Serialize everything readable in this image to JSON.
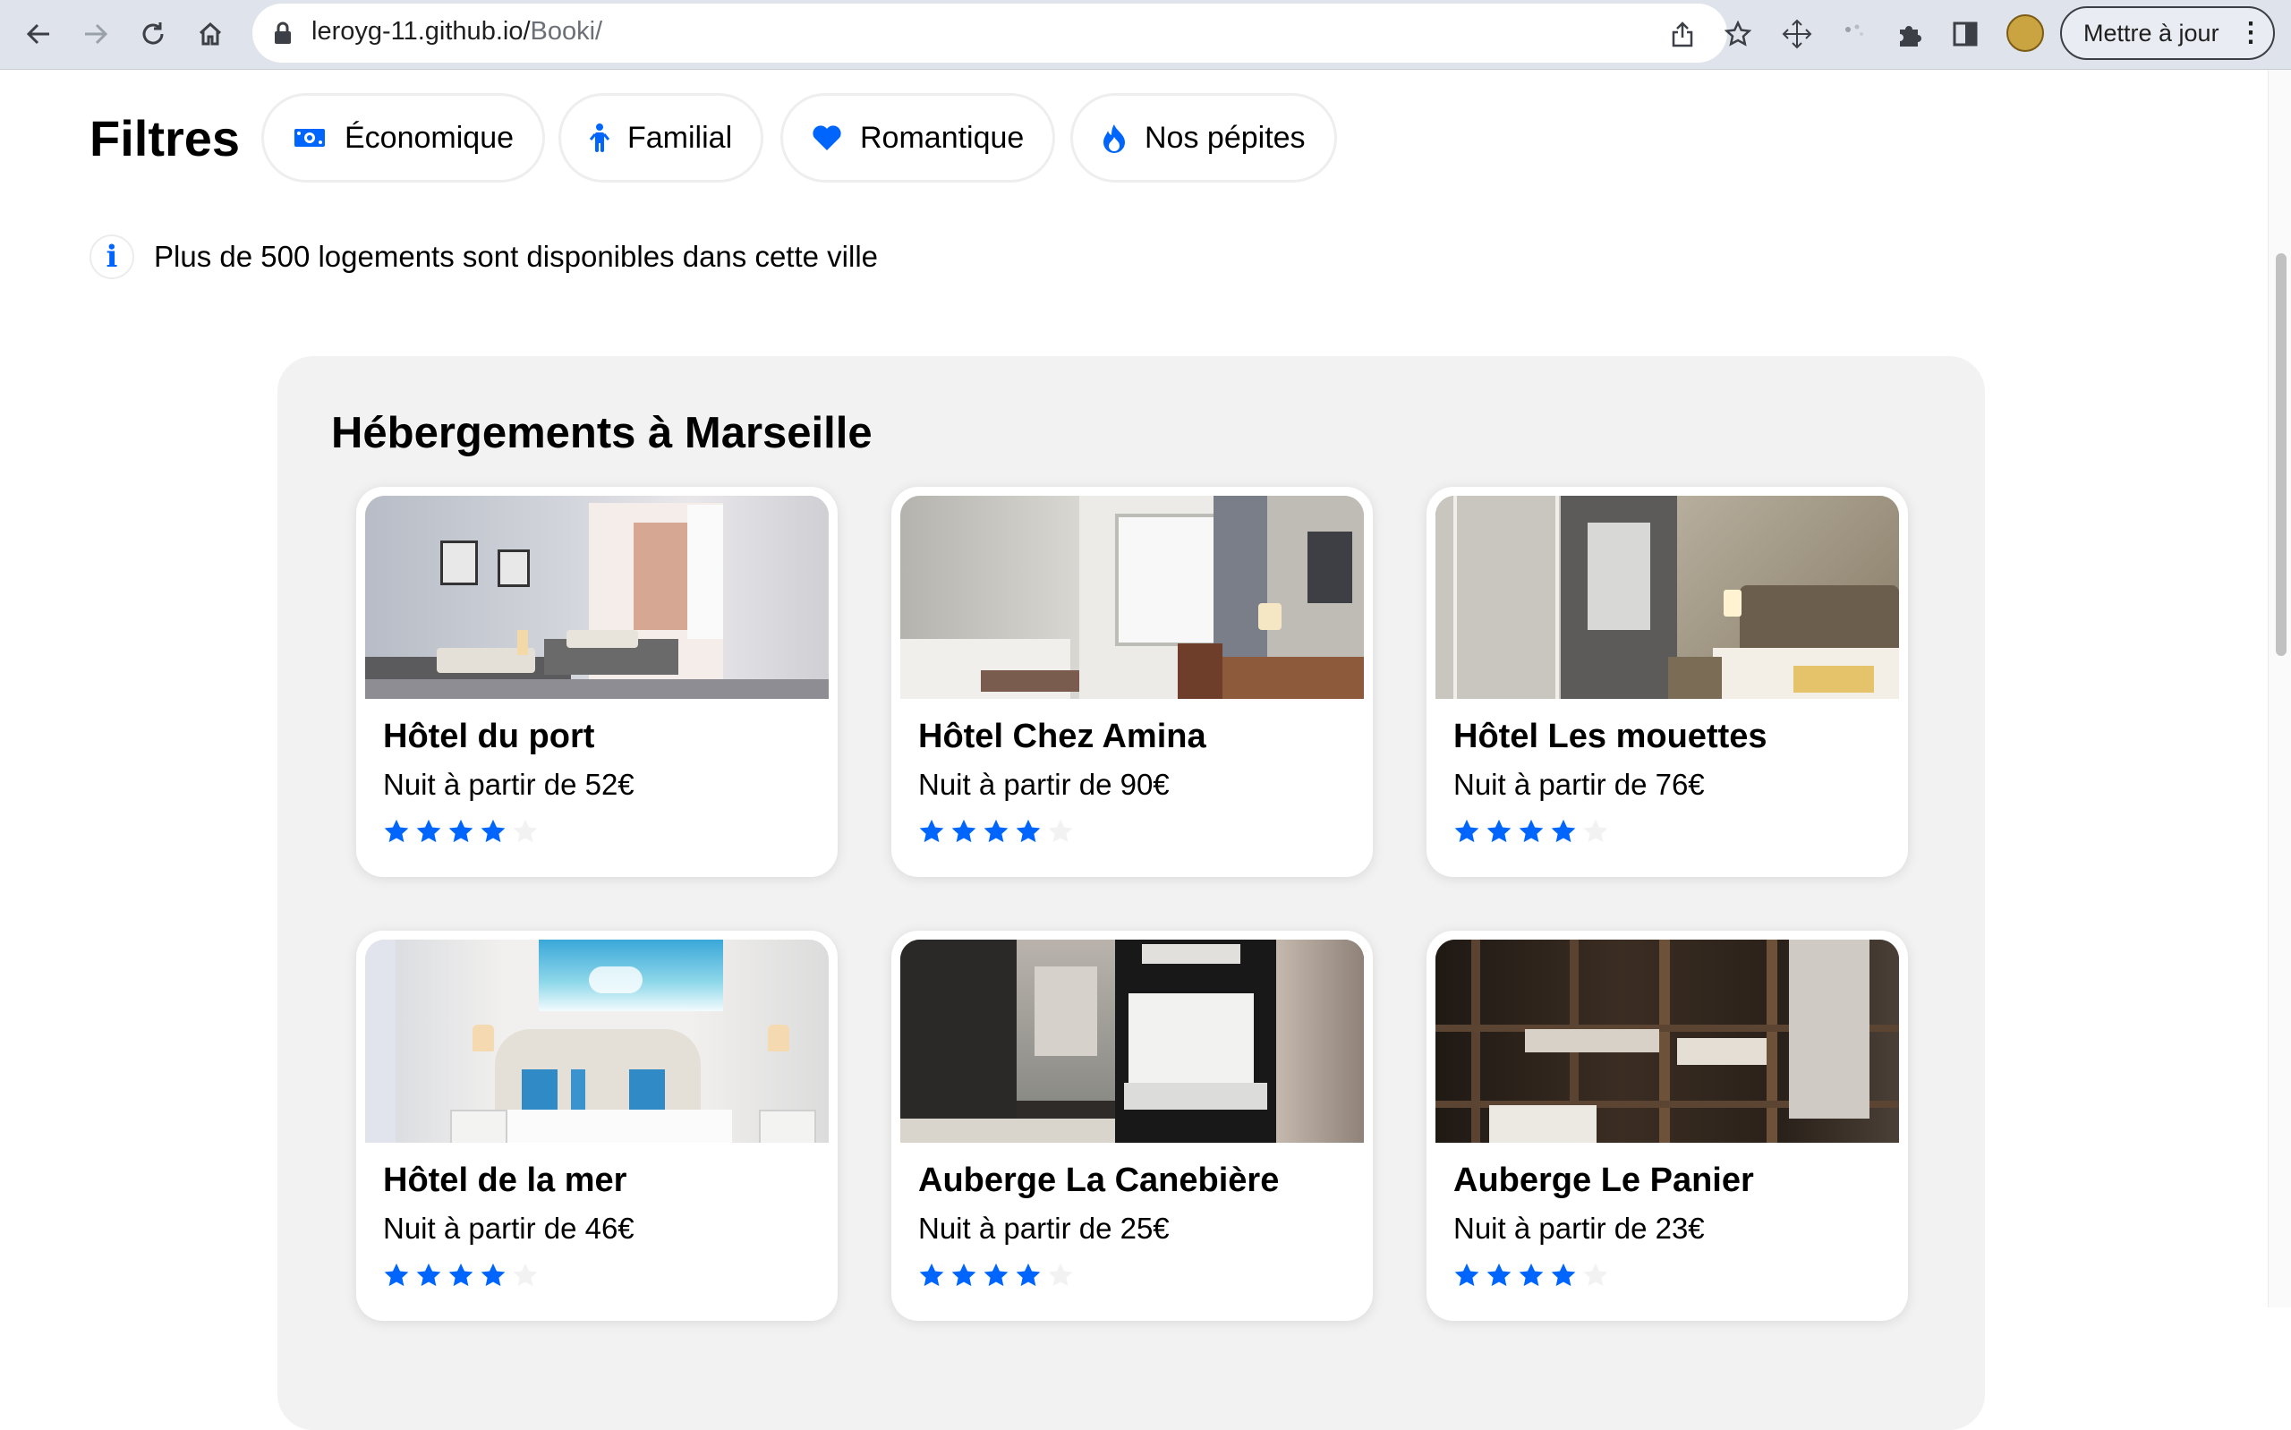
{
  "browser": {
    "url_host": "leroyg-11.github.io/",
    "url_path": "Booki/",
    "update_button": "Mettre à jour"
  },
  "filters": {
    "title": "Filtres",
    "items": [
      {
        "label": "Économique",
        "icon": "money-bill-icon"
      },
      {
        "label": "Familial",
        "icon": "child-icon"
      },
      {
        "label": "Romantique",
        "icon": "heart-icon"
      },
      {
        "label": "Nos pépites",
        "icon": "fire-icon"
      }
    ]
  },
  "info": {
    "text": "Plus de 500 logements sont disponibles dans cette ville"
  },
  "lodgings": {
    "title": "Hébergements à Marseille",
    "items": [
      {
        "name": "Hôtel du port",
        "price": "Nuit à partir de 52€",
        "rating": 4,
        "max_rating": 5
      },
      {
        "name": "Hôtel Chez Amina",
        "price": "Nuit à partir de 90€",
        "rating": 4,
        "max_rating": 5
      },
      {
        "name": "Hôtel Les mouettes",
        "price": "Nuit à partir de 76€",
        "rating": 4,
        "max_rating": 5
      },
      {
        "name": "Hôtel de la mer",
        "price": "Nuit à partir de 46€",
        "rating": 4,
        "max_rating": 5
      },
      {
        "name": "Auberge La Canebière",
        "price": "Nuit à partir de 25€",
        "rating": 4,
        "max_rating": 5
      },
      {
        "name": "Auberge Le Panier",
        "price": "Nuit à partir de 23€",
        "rating": 4,
        "max_rating": 5
      }
    ]
  },
  "colors": {
    "accent": "#0065fc",
    "star_off": "#f2f2f2",
    "section_bg": "#f2f2f2"
  }
}
